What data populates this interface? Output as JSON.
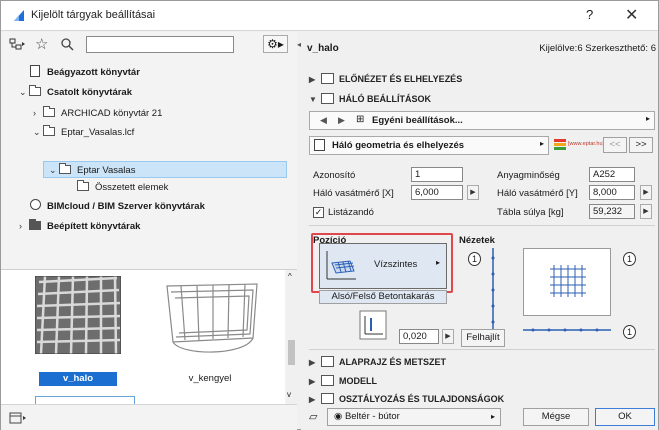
{
  "window": {
    "title": "Kijelölt tárgyak beállításai",
    "help": "?",
    "close": "✕"
  },
  "left": {
    "search_value": "",
    "tree": [
      {
        "label": "Beágyazott könyvtár",
        "bold": true
      },
      {
        "label": "Csatolt könyvtárak",
        "bold": true
      },
      {
        "label": "ARCHICAD könyvtár 21",
        "bold": false
      },
      {
        "label": "Eptar_Vasalas.lcf",
        "bold": false
      },
      {
        "label": "Eptar Vasalas",
        "bold": false
      },
      {
        "label": "Összetett elemek",
        "bold": false
      },
      {
        "label": "BIMcloud / BIM Szerver könyvtárak",
        "bold": true
      },
      {
        "label": "Beépített könyvtárak",
        "bold": true
      }
    ],
    "thumbs": [
      {
        "label": "v_halo",
        "selected": true
      },
      {
        "label": "v_kengyel",
        "selected": false
      }
    ]
  },
  "right": {
    "object_name": "v_halo",
    "selection_info": "Kijelölve:6 Szerkeszthető: 6",
    "sections": {
      "preview": "ELŐNÉZET ÉS ELHELYEZÉS",
      "mesh_settings": "HÁLÓ BEÁLLÍTÁSOK",
      "floorplan": "ALAPRAJZ ÉS METSZET",
      "model": "MODELL",
      "classification": "OSZTÁLYOZÁS ÉS TULAJDONSÁGOK"
    },
    "custom_settings": "Egyéni beállítások...",
    "geometry_tab": "Háló geometria és elhelyezés",
    "brand": "[www.eptar.hu]",
    "page_prev": "<<",
    "page_next": ">>",
    "fields": {
      "azonosito_label": "Azonosító",
      "azonosito_value": "1",
      "anyag_label": "Anyagminőség",
      "anyag_value": "A252",
      "vx_label": "Háló vasátmérő [X]",
      "vx_value": "6,000",
      "vy_label": "Háló vasátmérő [Y]",
      "vy_value": "8,000",
      "list_label": "Listázandó",
      "suly_label": "Tábla súlya [kg]",
      "suly_value": "59,232"
    },
    "pozicio_label": "Pozíció",
    "pozicio_value": "Vízszintes",
    "cover_label": "Alsó/Felső Betontakarás",
    "cover_value": "0,020",
    "nezetek_label": "Nézetek",
    "felhajlit": "Felhajlít",
    "view_numbers": [
      "1",
      "1",
      "1"
    ],
    "footer": {
      "layer": "Beltér - bútor",
      "cancel": "Mégse",
      "ok": "OK"
    }
  }
}
